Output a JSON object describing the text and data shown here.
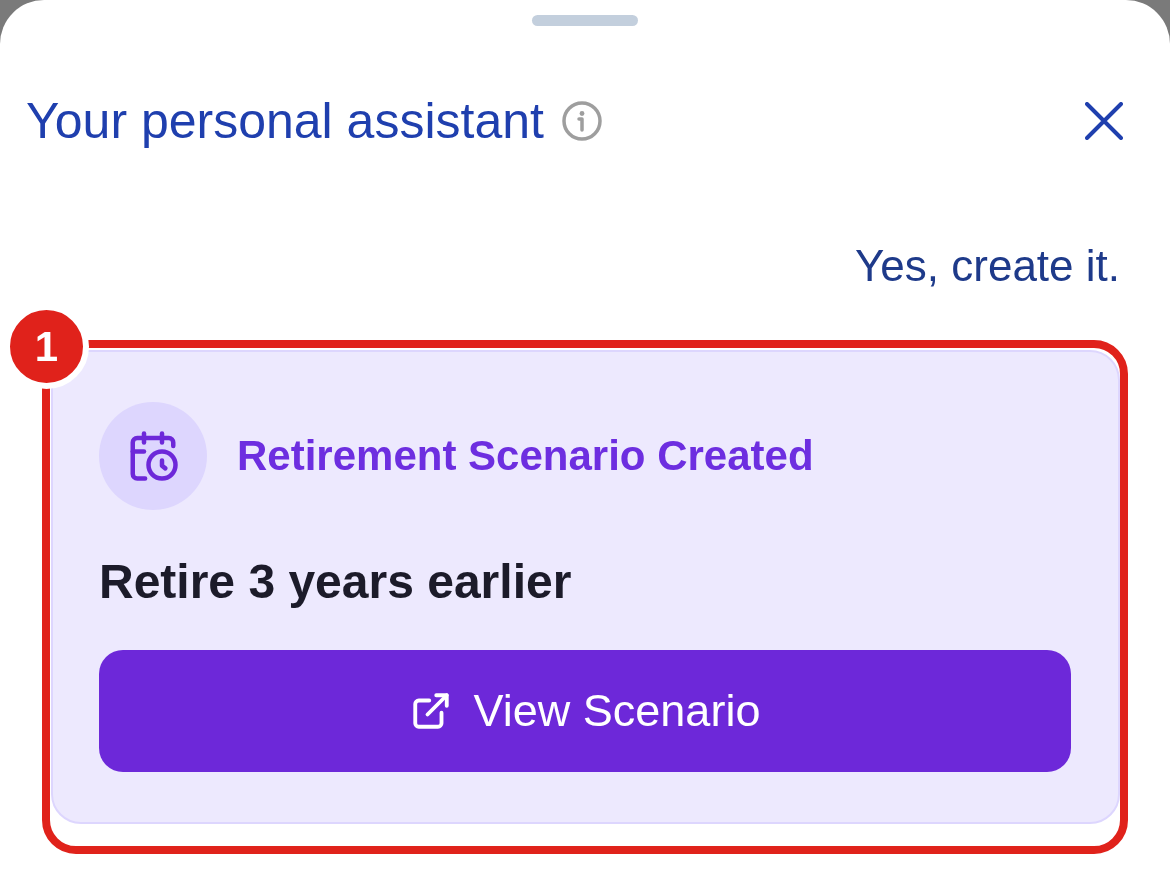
{
  "header": {
    "title": "Your personal assistant"
  },
  "conversation": [
    {
      "kind": "user",
      "text": "Yes, create it."
    },
    {
      "kind": "scenario_card",
      "annotation": {
        "label": "1"
      },
      "heading": "Retirement Scenario Created",
      "summary": "Retire 3 years earlier",
      "button": "View Scenario"
    }
  ]
}
